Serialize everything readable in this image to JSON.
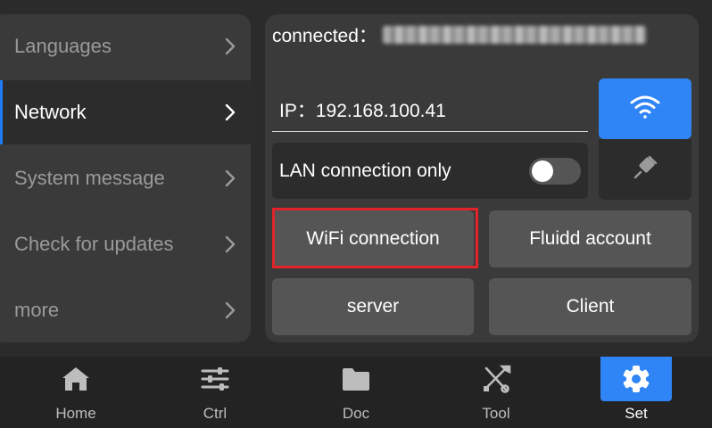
{
  "menu": {
    "items": [
      {
        "label": "Languages",
        "active": false
      },
      {
        "label": "Network",
        "active": true
      },
      {
        "label": "System message",
        "active": false
      },
      {
        "label": "Check for updates",
        "active": false
      },
      {
        "label": "more",
        "active": false
      }
    ]
  },
  "network": {
    "connected_label": "connected：",
    "ip_text": "IP：192.168.100.41",
    "lan_only_label": "LAN connection only",
    "lan_only_enabled": false,
    "wifi_tab_icon": "wifi-icon",
    "ethernet_tab_icon": "ethernet-icon",
    "buttons": {
      "wifi_connection": "WiFi connection",
      "fluidd_account": "Fluidd account",
      "server": "server",
      "client": "Client"
    }
  },
  "bottom_nav": {
    "items": [
      {
        "label": "Home",
        "icon": "home-icon",
        "active": false
      },
      {
        "label": "Ctrl",
        "icon": "sliders-icon",
        "active": false
      },
      {
        "label": "Doc",
        "icon": "folder-icon",
        "active": false
      },
      {
        "label": "Tool",
        "icon": "tools-icon",
        "active": false
      },
      {
        "label": "Set",
        "icon": "gear-icon",
        "active": true
      }
    ]
  },
  "colors": {
    "accent": "#2f84f6",
    "highlight": "#e0242a",
    "panel": "#3a3a3a",
    "button": "#555555"
  }
}
